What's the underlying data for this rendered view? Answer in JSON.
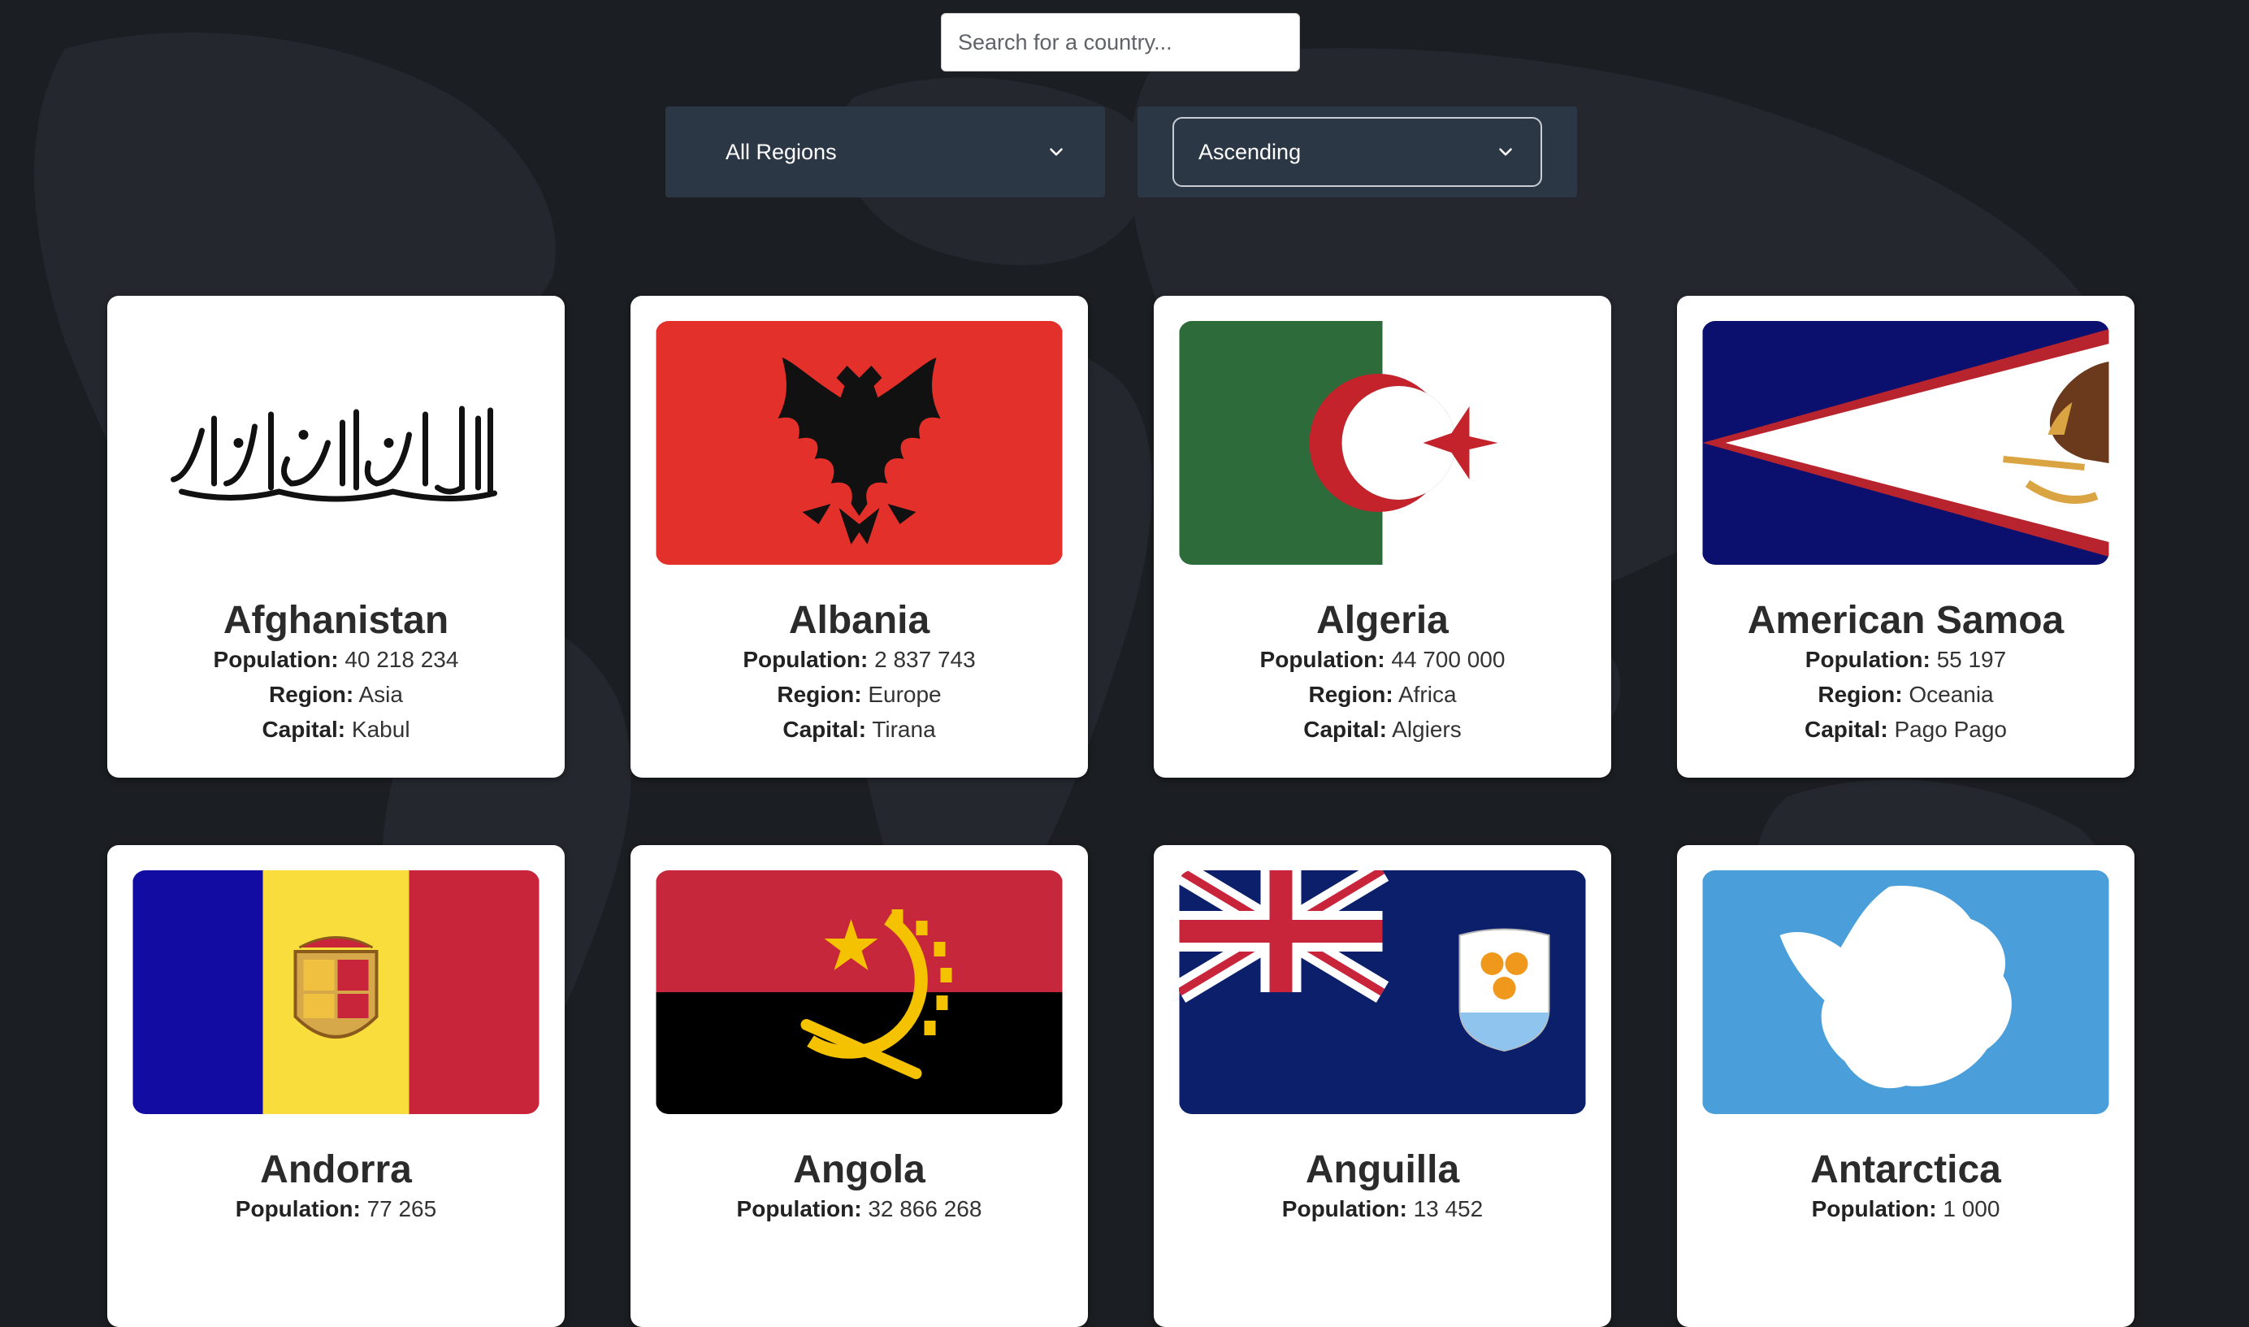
{
  "search": {
    "placeholder": "Search for a country..."
  },
  "filters": {
    "region": {
      "selected": "All Regions"
    },
    "sort": {
      "selected": "Ascending"
    }
  },
  "labels": {
    "population": "Population:",
    "region": "Region:",
    "capital": "Capital:"
  },
  "countries": [
    {
      "name": "Afghanistan",
      "population": "40 218 234",
      "region": "Asia",
      "capital": "Kabul"
    },
    {
      "name": "Albania",
      "population": "2 837 743",
      "region": "Europe",
      "capital": "Tirana"
    },
    {
      "name": "Algeria",
      "population": "44 700 000",
      "region": "Africa",
      "capital": "Algiers"
    },
    {
      "name": "American Samoa",
      "population": "55 197",
      "region": "Oceania",
      "capital": "Pago Pago"
    },
    {
      "name": "Andorra",
      "population": "77 265"
    },
    {
      "name": "Angola",
      "population": "32 866 268"
    },
    {
      "name": "Anguilla",
      "population": "13 452"
    },
    {
      "name": "Antarctica",
      "population": "1 000"
    }
  ],
  "colors": {
    "page_bg": "#1b1e22",
    "select_bg": "#2c3745",
    "card_bg": "#ffffff",
    "albania_red": "#e3302a",
    "algeria_green": "#2d6b3a",
    "algeria_red": "#c4232c",
    "samoa_blue": "#0b0f6e",
    "samoa_red": "#b8242d",
    "andorra_blue": "#120ca3",
    "andorra_yellow": "#f8dd3c",
    "andorra_red": "#c8243a",
    "angola_red": "#c6273a",
    "angola_yellow": "#f5c200",
    "anguilla_blue": "#0b1f6a",
    "antarctica_blue": "#4a9fda"
  }
}
